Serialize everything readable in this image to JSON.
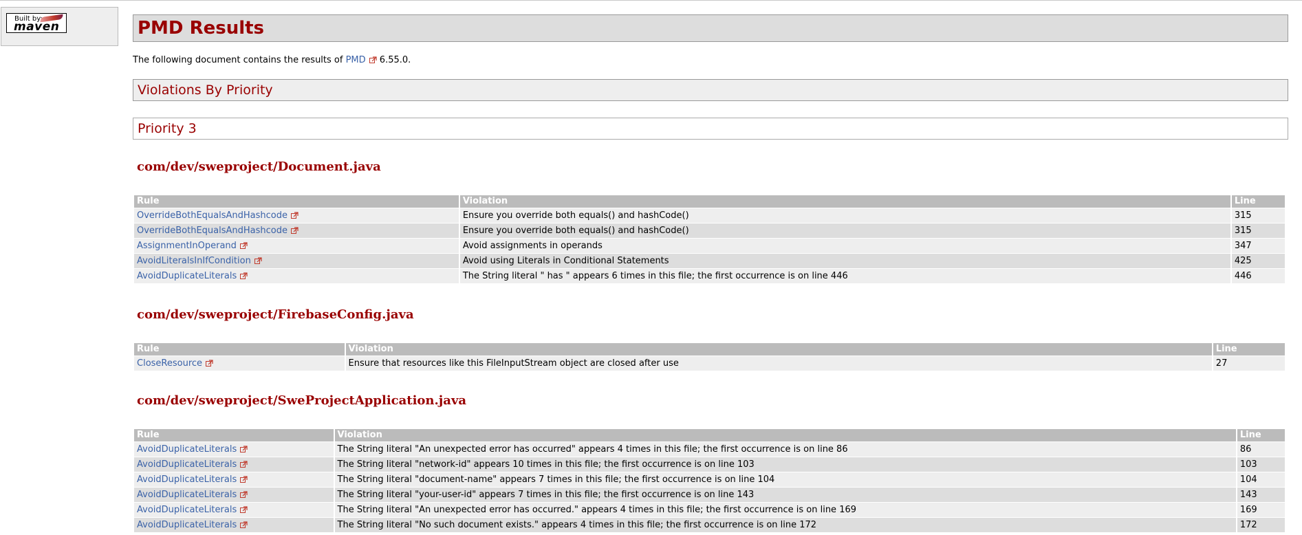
{
  "badge": {
    "built_by": "Built by:",
    "maven": "maven"
  },
  "title": "PMD Results",
  "intro": {
    "prefix": "The following document contains the results of ",
    "link": "PMD",
    "suffix": " 6.55.0."
  },
  "section_priority_heading": "Violations By Priority",
  "priority_heading": "Priority 3",
  "columns": {
    "rule": "Rule",
    "violation": "Violation",
    "line": "Line"
  },
  "files": [
    {
      "name": "com/dev/sweproject/Document.java",
      "rows": [
        {
          "rule": "OverrideBothEqualsAndHashcode",
          "violation": "Ensure you override both equals() and hashCode()",
          "line": "315"
        },
        {
          "rule": "OverrideBothEqualsAndHashcode",
          "violation": "Ensure you override both equals() and hashCode()",
          "line": "315"
        },
        {
          "rule": "AssignmentInOperand",
          "violation": "Avoid assignments in operands",
          "line": "347"
        },
        {
          "rule": "AvoidLiteralsInIfCondition",
          "violation": "Avoid using Literals in Conditional Statements",
          "line": "425"
        },
        {
          "rule": "AvoidDuplicateLiterals",
          "violation": "The String literal \" has \" appears 6 times in this file; the first occurrence is on line 446",
          "line": "446"
        }
      ]
    },
    {
      "name": "com/dev/sweproject/FirebaseConfig.java",
      "rows": [
        {
          "rule": "CloseResource",
          "violation": "Ensure that resources like this FileInputStream object are closed after use",
          "line": "27"
        }
      ]
    },
    {
      "name": "com/dev/sweproject/SweProjectApplication.java",
      "rows": [
        {
          "rule": "AvoidDuplicateLiterals",
          "violation": "The String literal \"An unexpected error has occurred\" appears 4 times in this file; the first occurrence is on line 86",
          "line": "86"
        },
        {
          "rule": "AvoidDuplicateLiterals",
          "violation": "The String literal \"network-id\" appears 10 times in this file; the first occurrence is on line 103",
          "line": "103"
        },
        {
          "rule": "AvoidDuplicateLiterals",
          "violation": "The String literal \"document-name\" appears 7 times in this file; the first occurrence is on line 104",
          "line": "104"
        },
        {
          "rule": "AvoidDuplicateLiterals",
          "violation": "The String literal \"your-user-id\" appears 7 times in this file; the first occurrence is on line 143",
          "line": "143"
        },
        {
          "rule": "AvoidDuplicateLiterals",
          "violation": "The String literal \"An unexpected error has occurred.\" appears 4 times in this file; the first occurrence is on line 169",
          "line": "169"
        },
        {
          "rule": "AvoidDuplicateLiterals",
          "violation": "The String literal \"No such document exists.\" appears 4 times in this file; the first occurrence is on line 172",
          "line": "172"
        }
      ]
    }
  ],
  "icons": {
    "external_link": "external-link-icon"
  },
  "colors": {
    "heading": "#990000",
    "link": "#3a62a8"
  }
}
